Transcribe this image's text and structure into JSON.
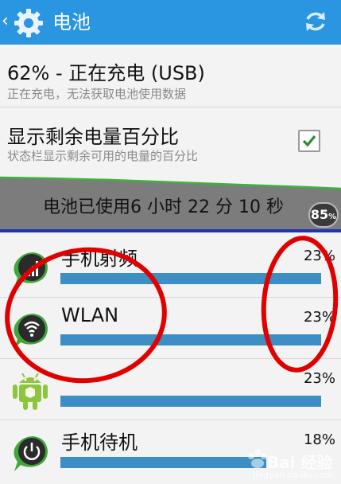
{
  "header": {
    "back": "‹",
    "title": "电池",
    "icons": {
      "app": "gear-icon",
      "refresh": "refresh-icon"
    }
  },
  "status": {
    "title": "62% - 正在充电 (USB)",
    "subtitle": "正在充电，无法获取电池使用数据"
  },
  "percentage_setting": {
    "title": "显示剩余电量百分比",
    "subtitle": "状态栏显示剩余可用的电量的百分比",
    "checked": true
  },
  "graph": {
    "label": "电池已使用6 小时 22 分 10 秒",
    "badge_value": "85",
    "badge_unit": "%"
  },
  "apps": [
    {
      "name": "手机射频",
      "percent_label": "23%",
      "percent": 0.95,
      "icon": "signal-icon"
    },
    {
      "name": "WLAN",
      "percent_label": "23%",
      "percent": 0.95,
      "icon": "wifi-icon"
    },
    {
      "name": "",
      "percent_label": "23%",
      "percent": 0.95,
      "icon": "android-icon"
    },
    {
      "name": "手机待机",
      "percent_label": "18%",
      "percent": 0.75,
      "icon": "power-icon"
    }
  ],
  "watermark": {
    "text": "Bai 经验",
    "url": "jingyan.baidu.com"
  },
  "colors": {
    "actionbar": "#2a95e0",
    "bar": "#3d8ec4",
    "annotation": "#e00000"
  }
}
